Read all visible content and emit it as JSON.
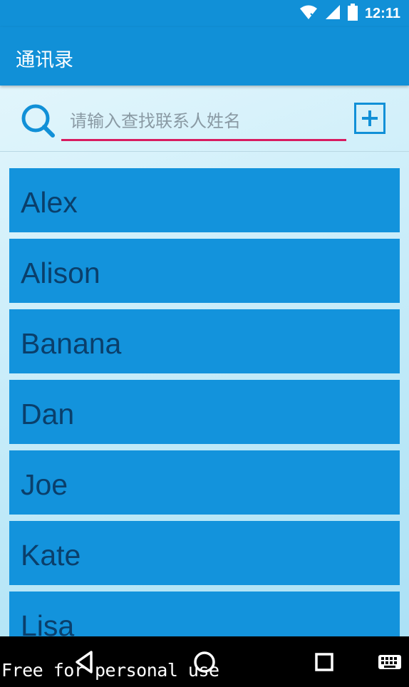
{
  "status_bar": {
    "time": "12:11",
    "icons": [
      "wifi-icon",
      "signal-icon",
      "battery-icon"
    ]
  },
  "app_bar": {
    "title": "通讯录"
  },
  "search": {
    "icon": "search-icon",
    "placeholder": "请输入查找联系人姓名",
    "value": "",
    "add_icon": "plus-square-icon"
  },
  "contacts": [
    {
      "name": "Alex"
    },
    {
      "name": "Alison"
    },
    {
      "name": "Banana"
    },
    {
      "name": "Dan"
    },
    {
      "name": "Joe"
    },
    {
      "name": "Kate"
    },
    {
      "name": "Lisa"
    }
  ],
  "nav_bar": {
    "buttons": [
      "back-icon",
      "home-icon",
      "recents-icon",
      "keyboard-icon"
    ]
  },
  "watermark": "Free for personal use",
  "colors": {
    "primary": "#1190d7",
    "list_item": "#1393dc",
    "list_text": "#0a3f6b",
    "input_underline": "#d81b60",
    "nav_bar": "#000000"
  }
}
